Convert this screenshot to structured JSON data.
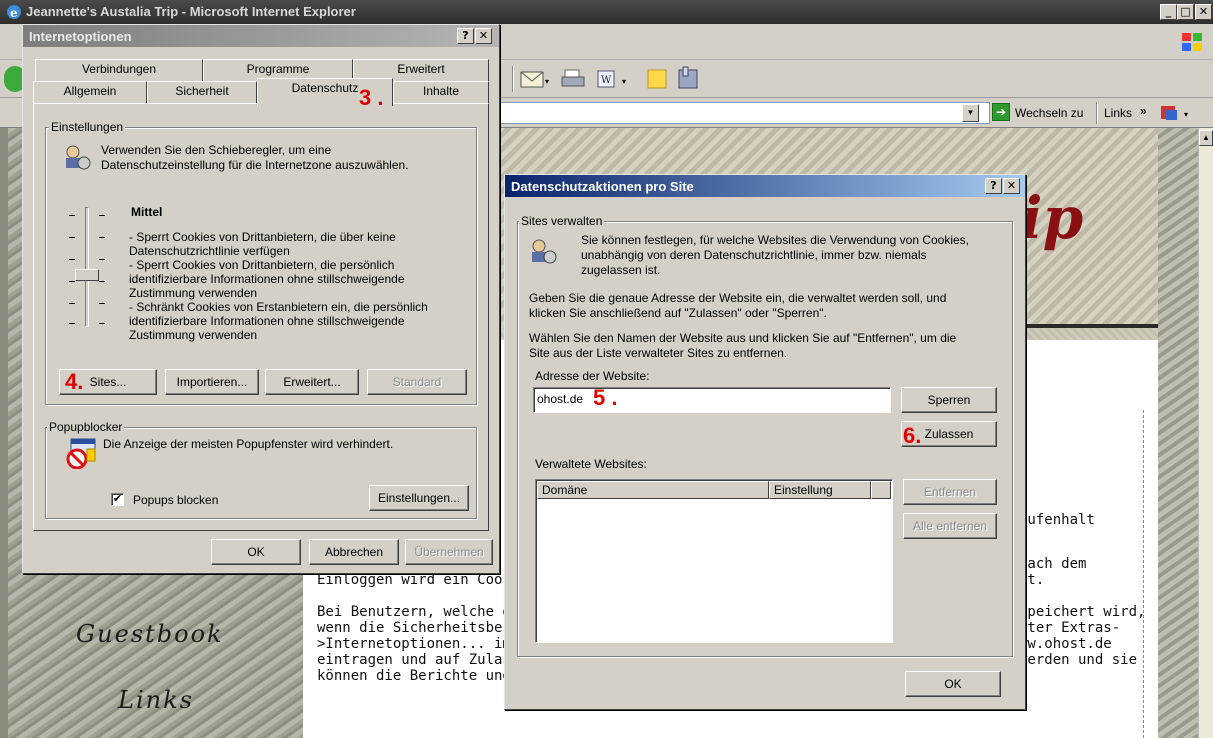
{
  "browser": {
    "title": "Jeannette's Austalia Trip - Microsoft Internet Explorer",
    "window_controls": [
      "_",
      "□",
      "✕"
    ],
    "address_bar": {
      "go_label": "Wechseln zu",
      "links_label": "Links",
      "links_chevron": "»"
    }
  },
  "webpage": {
    "banner_script": "rip",
    "nav": {
      "guestbook": "Guestbook",
      "links": "Links"
    },
    "body_left": [
      "Einloggen wird ein Cookie",
      "",
      "Bei Benutzern, welche de",
      "wenn die Sicherheitsbest",
      ">Internetoptionen... im R",
      "eintragen und auf Zulass",
      "können die Berichte und"
    ],
    "body_right": [
      "aufenhalt",
      "",
      "Nach dem",
      "nt.",
      "",
      "speichert wird,",
      "nter Extras-",
      "ww.ohost.de",
      "werden und sie"
    ]
  },
  "internet_options": {
    "title": "Internetoptionen",
    "title_controls": [
      "?",
      "✕"
    ],
    "tabs_back": [
      "Verbindungen",
      "Programme",
      "Erweitert"
    ],
    "tabs_front": [
      "Allgemein",
      "Sicherheit",
      "Datenschutz",
      "Inhalte"
    ],
    "active_tab": "Datenschutz",
    "settings_group": "Einstellungen",
    "settings_intro": [
      "Verwenden Sie den Schieberegler, um eine",
      "Datenschutzeinstellung für die Internetzone auszuwählen."
    ],
    "level_title": "Mittel",
    "level_description": [
      "- Sperrt Cookies von Drittanbietern, die über keine",
      "Datenschutzrichtlinie verfügen",
      "- Sperrt Cookies von Drittanbietern, die persönlich",
      "identifizierbare Informationen ohne stillschweigende",
      "Zustimmung verwenden",
      "- Schränkt Cookies von Erstanbietern ein, die persönlich",
      "identifizierbare Informationen ohne stillschweigende",
      "Zustimmung verwenden"
    ],
    "buttons": {
      "sites": "Sites...",
      "import": "Importieren...",
      "advanced": "Erweitert...",
      "default": "Standard"
    },
    "popup_group": "Popupblocker",
    "popup_text": "Die Anzeige der meisten Popupfenster wird verhindert.",
    "popup_checkbox_label": "Popups blocken",
    "popup_checked": true,
    "popup_settings_button": "Einstellungen...",
    "footer": {
      "ok": "OK",
      "cancel": "Abbrechen",
      "apply": "Übernehmen"
    }
  },
  "per_site": {
    "title": "Datenschutzaktionen pro Site",
    "title_controls": [
      "?",
      "✕"
    ],
    "group": "Sites verwalten",
    "intro": [
      "Sie können festlegen, für welche Websites die Verwendung von Cookies,",
      "unabhängig von deren Datenschutzrichtlinie, immer bzw. niemals",
      "zugelassen ist."
    ],
    "para2": [
      "Geben Sie die genaue Adresse der Website ein, die verwaltet werden soll, und",
      "klicken Sie anschließend auf \"Zulassen\" oder \"Sperren\"."
    ],
    "para3": [
      "Wählen Sie den Namen der Website aus und klicken Sie auf \"Entfernen\", um die",
      "Site aus der Liste verwalteter Sites zu entfernen."
    ],
    "address_label": "Adresse der Website:",
    "address_value": "ohost.de",
    "block_button": "Sperren",
    "allow_button": "Zulassen",
    "managed_label": "Verwaltete Websites:",
    "columns": [
      "Domäne",
      "Einstellung"
    ],
    "remove_button": "Entfernen",
    "remove_all_button": "Alle entfernen",
    "ok_button": "OK"
  },
  "steps": {
    "s3": "3 .",
    "s4": "4.",
    "s5": "5 .",
    "s6": "6."
  },
  "colors": {
    "dialog_bg": "#d4d0c8",
    "title_active": "#0a246a",
    "title_inactive": "#808080",
    "step_red": "#e00000"
  }
}
